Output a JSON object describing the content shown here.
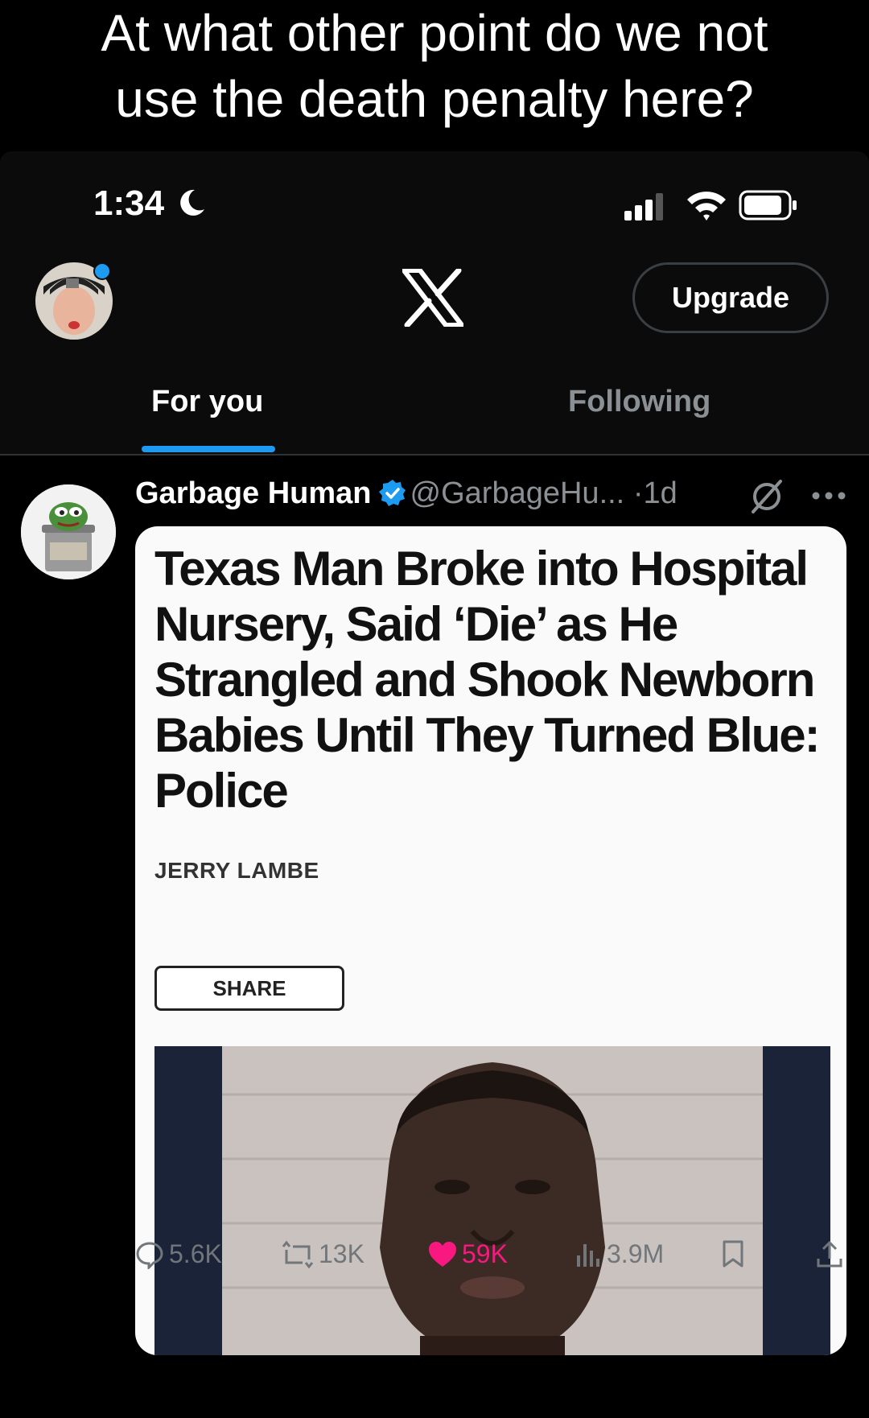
{
  "caption": {
    "line1": "At what other point do we not",
    "line2": "use the death penalty here?"
  },
  "status_bar": {
    "time": "1:34",
    "icons": [
      "moon-icon",
      "cellular-signal-icon",
      "wifi-icon",
      "battery-icon"
    ]
  },
  "header": {
    "logo": "x-logo-icon",
    "upgrade_label": "Upgrade"
  },
  "tabs": [
    {
      "label": "For you",
      "active": true
    },
    {
      "label": "Following",
      "active": false
    }
  ],
  "post": {
    "author_name": "Garbage Human",
    "handle": "@GarbageHu...",
    "separator": "·",
    "time": "1d",
    "card": {
      "headline": "Texas Man Broke into Hospital Nursery, Said ‘Die’ as He Strangled and Shook Newborn Babies Until They Turned Blue: Police",
      "author": "JERRY LAMBE",
      "share_label": "SHARE"
    },
    "actions": {
      "replies": "5.6K",
      "reposts": "13K",
      "likes": "59K",
      "views": "3.9M"
    }
  },
  "colors": {
    "accent": "#1d9bf0",
    "like": "#f91880",
    "background": "#000000"
  }
}
